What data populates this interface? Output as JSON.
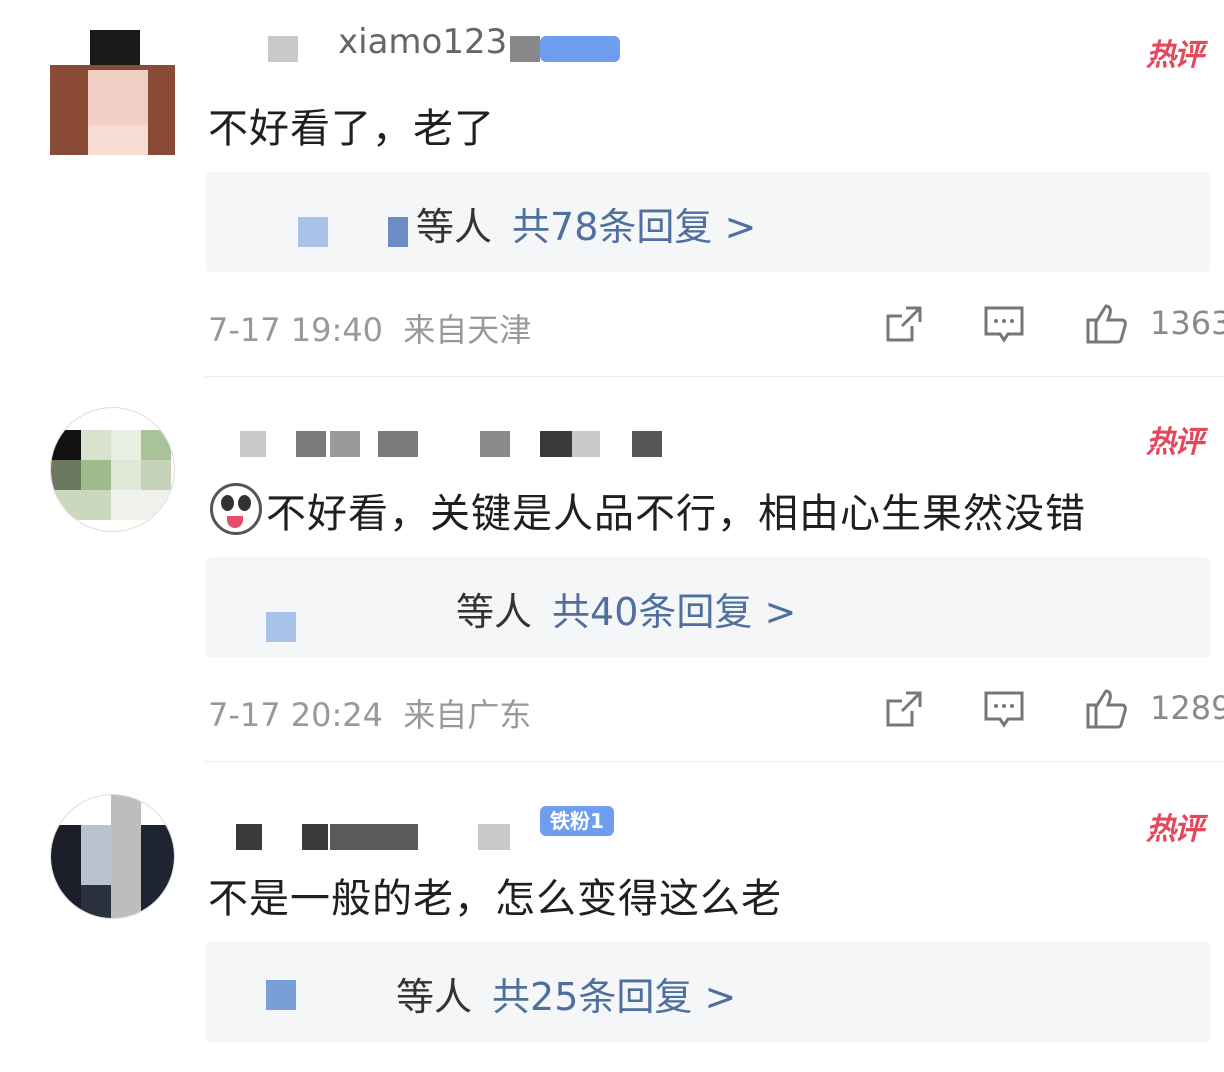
{
  "hot_label": "热评",
  "comments": [
    {
      "username_visible": "xiamo123",
      "text": "不好看了，老了",
      "reply_who": "等人",
      "reply_count": "共78条回复 >",
      "time": "7-17 19:40",
      "location": "来自天津",
      "likes": "1363",
      "has_emoji": false
    },
    {
      "username_visible": "",
      "text": "不好看，关键是人品不行，相由心生果然没错",
      "reply_who": "等人",
      "reply_count": "共40条回复 >",
      "time": "7-17 20:24",
      "location": "来自广东",
      "likes": "1289",
      "has_emoji": true
    },
    {
      "username_visible": "",
      "badge": "铁粉1",
      "text": "不是一般的老，怎么变得这么老",
      "reply_who": "等人",
      "reply_count": "共25条回复 >",
      "time": "",
      "location": "",
      "likes": "",
      "has_emoji": false
    }
  ],
  "icons": [
    "share-icon",
    "comment-icon",
    "like-icon"
  ],
  "colors": {
    "hot": "#e5485a",
    "reply_link": "#4f6f9f",
    "badge": "#6f9ef0"
  }
}
